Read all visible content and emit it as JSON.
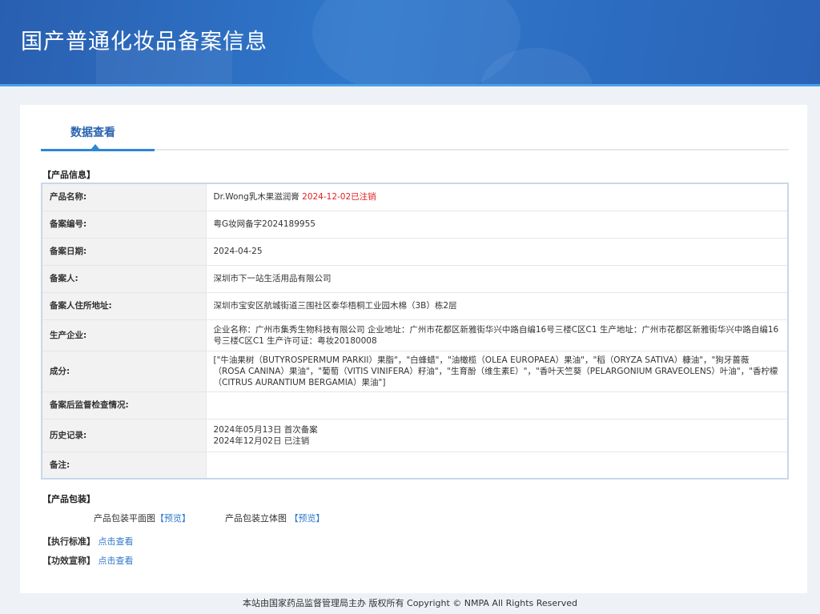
{
  "header": {
    "title": "国产普通化妆品备案信息"
  },
  "tab": {
    "label": "数据查看"
  },
  "product_info": {
    "section": "【产品信息】",
    "rows": [
      {
        "label": "产品名称:",
        "value": "Dr.Wong乳木果滋润膏",
        "status": "2024-12-02已注销"
      },
      {
        "label": "备案编号:",
        "value": "粤G妆网备字2024189955"
      },
      {
        "label": "备案日期:",
        "value": "2024-04-25"
      },
      {
        "label": "备案人:",
        "value": "深圳市下一站生活用品有限公司"
      },
      {
        "label": "备案人住所地址:",
        "value": "深圳市宝安区航城街道三围社区泰华梧桐工业园木棉（3B）栋2层"
      },
      {
        "label": "生产企业:",
        "value": "企业名称：广州市集秀生物科技有限公司 企业地址：广州市花都区新雅街华兴中路自编16号三楼C区C1 生产地址：广州市花都区新雅街华兴中路自编16号三楼C区C1 生产许可证：粤妆20180008"
      },
      {
        "label": "成分:",
        "value": "[\"牛油果树（BUTYROSPERMUM PARKII）果脂\"，\"白蜂蜡\"，\"油橄榄（OLEA EUROPAEA）果油\"，\"稻（ORYZA SATIVA）糠油\"，\"狗牙蔷薇（ROSA CANINA）果油\"，\"葡萄（VITIS VINIFERA）籽油\"，\"生育酚（维生素E）\"，\"香叶天竺葵（PELARGONIUM GRAVEOLENS）叶油\"，\"香柠檬（CITRUS AURANTIUM BERGAMIA）果油\"]"
      },
      {
        "label": "备案后监督检查情况:",
        "value": ""
      },
      {
        "label": "历史记录:",
        "value": "2024年05月13日 首次备案",
        "value2": "2024年12月02日 已注销"
      },
      {
        "label": "备注:",
        "value": ""
      }
    ]
  },
  "packaging": {
    "section": "【产品包装】",
    "flat_label": "产品包装平面图",
    "flat_link": "【预览】",
    "solid_label": "产品包装立体图",
    "solid_link": "【预览】"
  },
  "standard": {
    "label": "【执行标准】",
    "link": "点击查看"
  },
  "efficacy": {
    "label": "【功效宣称】",
    "link": "点击查看"
  },
  "footer": {
    "text": "本站由国家药品监督管理局主办 版权所有 Copyright © NMPA All Rights Reserved"
  }
}
